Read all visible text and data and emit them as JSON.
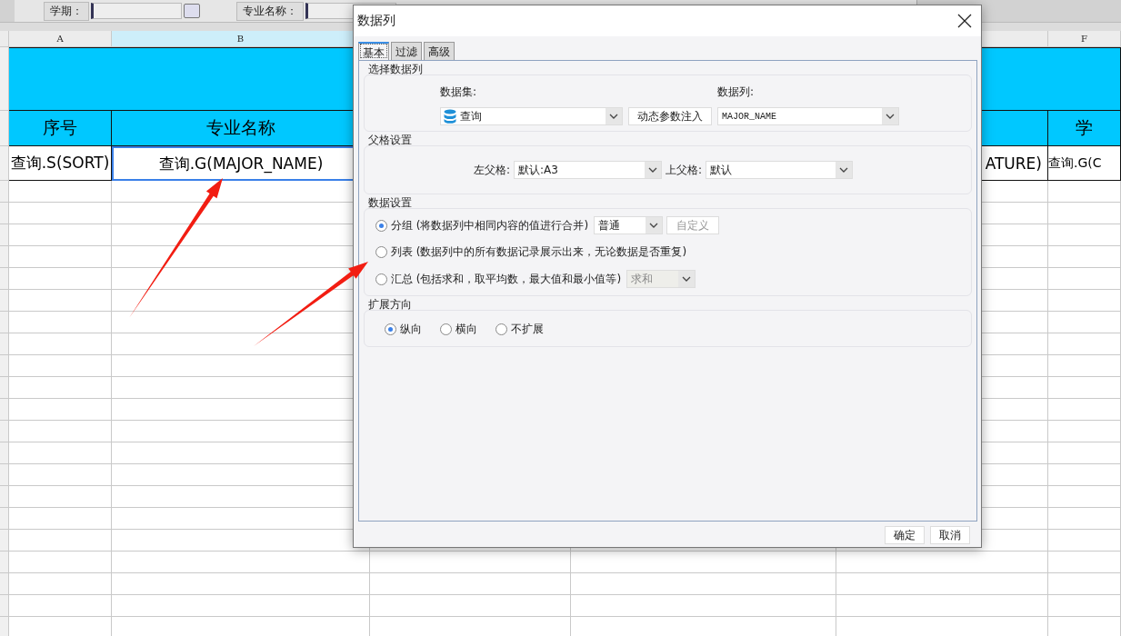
{
  "toolbar": {
    "fields": [
      {
        "label": "学期："
      },
      {
        "label": "专业名称："
      }
    ]
  },
  "sheet": {
    "column_headers": [
      {
        "label": "A",
        "selected": false
      },
      {
        "label": "B",
        "selected": true
      },
      {
        "label": "F",
        "selected": false
      }
    ],
    "titles": [
      "序号",
      "专业名称",
      "学"
    ],
    "cells": [
      {
        "text": "查询.S(SORT)",
        "selected": false
      },
      {
        "text": "查询.G(MAJOR_NAME)",
        "selected": true
      },
      {
        "text": "ATURE)",
        "selected": false
      },
      {
        "text": "查询.G(C",
        "selected": false
      }
    ]
  },
  "dialog": {
    "title": "数据列",
    "tabs": [
      {
        "label": "基本",
        "selected": true
      },
      {
        "label": "过滤",
        "selected": false
      },
      {
        "label": "高级",
        "selected": false
      }
    ],
    "data_column": {
      "title": "选择数据列",
      "dataset_label": "数据集:",
      "dataset_value": "查询",
      "inject_button": "动态参数注入",
      "column_label": "数据列:",
      "column_value": "MAJOR_NAME"
    },
    "parent_cell": {
      "title": "父格设置",
      "left_label": "左父格:",
      "left_value": "默认:A3",
      "top_label": "上父格:",
      "top_value": "默认"
    },
    "data_setting": {
      "title": "数据设置",
      "options": [
        {
          "label": "分组 (将数据列中相同内容的值进行合并)",
          "selected": true,
          "select_value": "普通",
          "select_disabled": false,
          "button": "自定义",
          "button_disabled": true
        },
        {
          "label": "列表 (数据列中的所有数据记录展示出来，无论数据是否重复)",
          "selected": false
        },
        {
          "label": "汇总 (包括求和，取平均数，最大值和最小值等)",
          "selected": false,
          "select_value": "求和",
          "select_disabled": true
        }
      ]
    },
    "expand": {
      "title": "扩展方向",
      "options": [
        {
          "label": "纵向",
          "selected": true
        },
        {
          "label": "横向",
          "selected": false
        },
        {
          "label": "不扩展",
          "selected": false
        }
      ]
    },
    "buttons": [
      "确定",
      "取消"
    ]
  }
}
